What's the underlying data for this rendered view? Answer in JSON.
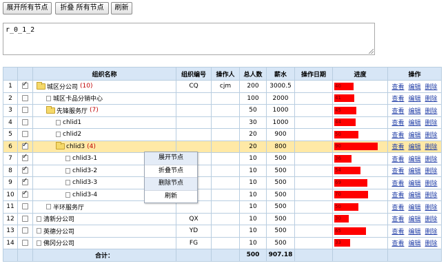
{
  "toolbar": {
    "expand_all": "展开所有节点",
    "collapse_all": "折叠 所有节点",
    "refresh": "刷新"
  },
  "textarea": {
    "value": "r_0_1_2"
  },
  "columns": [
    "",
    "",
    "组织名称",
    "组织编号",
    "操作人",
    "总人数",
    "薪水",
    "操作日期",
    "进度",
    "操作"
  ],
  "rows": [
    {
      "no": "1",
      "checked": true,
      "indent": 0,
      "kind": "folder",
      "name": "城区分公司",
      "count": "(10)",
      "code": "CQ",
      "operator": "cjm",
      "total": "200",
      "salary": "3000.5",
      "date": "",
      "progress": 40,
      "progress_label": "40"
    },
    {
      "no": "2",
      "checked": false,
      "indent": 1,
      "kind": "leaf",
      "name": "城区卡品分销中心",
      "count": "",
      "code": "",
      "operator": "",
      "total": "100",
      "salary": "2000",
      "date": "",
      "progress": 41,
      "progress_label": "41"
    },
    {
      "no": "3",
      "checked": false,
      "indent": 1,
      "kind": "folder",
      "name": "先锋服务厅",
      "count": "(7)",
      "code": "",
      "operator": "",
      "total": "50",
      "salary": "1000",
      "date": "",
      "progress": 45,
      "progress_label": "45"
    },
    {
      "no": "4",
      "checked": false,
      "indent": 2,
      "kind": "leaf",
      "name": "chlid1",
      "count": "",
      "code": "",
      "operator": "",
      "total": "30",
      "salary": "1000",
      "date": "",
      "progress": 44,
      "progress_label": "44"
    },
    {
      "no": "5",
      "checked": false,
      "indent": 2,
      "kind": "leaf",
      "name": "chlid2",
      "count": "",
      "code": "",
      "operator": "",
      "total": "20",
      "salary": "900",
      "date": "",
      "progress": 50,
      "progress_label": "50"
    },
    {
      "no": "6",
      "checked": true,
      "indent": 2,
      "kind": "folder",
      "name": "chlid3",
      "count": "(4)",
      "code": "",
      "operator": "",
      "total": "20",
      "salary": "800",
      "date": "",
      "progress": 90,
      "progress_label": "90",
      "selected": true
    },
    {
      "no": "7",
      "checked": true,
      "indent": 3,
      "kind": "leaf",
      "name": "chlid3-1",
      "count": "",
      "code": "",
      "operator": "",
      "total": "10",
      "salary": "500",
      "date": "",
      "progress": 36,
      "progress_label": "36"
    },
    {
      "no": "8",
      "checked": true,
      "indent": 3,
      "kind": "leaf",
      "name": "chlid3-2",
      "count": "",
      "code": "",
      "operator": "",
      "total": "10",
      "salary": "500",
      "date": "",
      "progress": 54,
      "progress_label": "54"
    },
    {
      "no": "9",
      "checked": true,
      "indent": 3,
      "kind": "leaf",
      "name": "chlid3-3",
      "count": "",
      "code": "",
      "operator": "",
      "total": "10",
      "salary": "500",
      "date": "",
      "progress": 69,
      "progress_label": "69"
    },
    {
      "no": "10",
      "checked": true,
      "indent": 3,
      "kind": "leaf",
      "name": "chlid3-4",
      "count": "",
      "code": "",
      "operator": "",
      "total": "10",
      "salary": "500",
      "date": "",
      "progress": 70,
      "progress_label": "70"
    },
    {
      "no": "11",
      "checked": false,
      "indent": 1,
      "kind": "leaf",
      "name": "半环服务厅",
      "count": "",
      "code": "",
      "operator": "",
      "total": "10",
      "salary": "500",
      "date": "",
      "progress": 50,
      "progress_label": "50"
    },
    {
      "no": "12",
      "checked": false,
      "indent": 0,
      "kind": "leaf",
      "name": "清新分公司",
      "count": "",
      "code": "QX",
      "operator": "",
      "total": "10",
      "salary": "500",
      "date": "",
      "progress": 30,
      "progress_label": "30"
    },
    {
      "no": "13",
      "checked": false,
      "indent": 0,
      "kind": "leaf",
      "name": "英德分公司",
      "count": "",
      "code": "YD",
      "operator": "",
      "total": "10",
      "salary": "500",
      "date": "",
      "progress": 65,
      "progress_label": "65"
    },
    {
      "no": "14",
      "checked": false,
      "indent": 0,
      "kind": "leaf",
      "name": "佛冈分公司",
      "count": "",
      "code": "FG",
      "operator": "",
      "total": "10",
      "salary": "500",
      "date": "",
      "progress": 33,
      "progress_label": "33"
    }
  ],
  "row_actions": {
    "view": "查看",
    "edit": "编辑",
    "delete": "删除"
  },
  "footer": {
    "label": "合计：",
    "total": "500",
    "salary": "907.18"
  },
  "context_menu": [
    "展开节点",
    "折叠节点",
    "删除节点",
    "刷新"
  ],
  "colors": {
    "header_bg": "#d7e6f6",
    "selected_row": "#ffe9a6",
    "progress_bar": "#ff0000",
    "link": "#2340a8",
    "count": "#c00000"
  }
}
